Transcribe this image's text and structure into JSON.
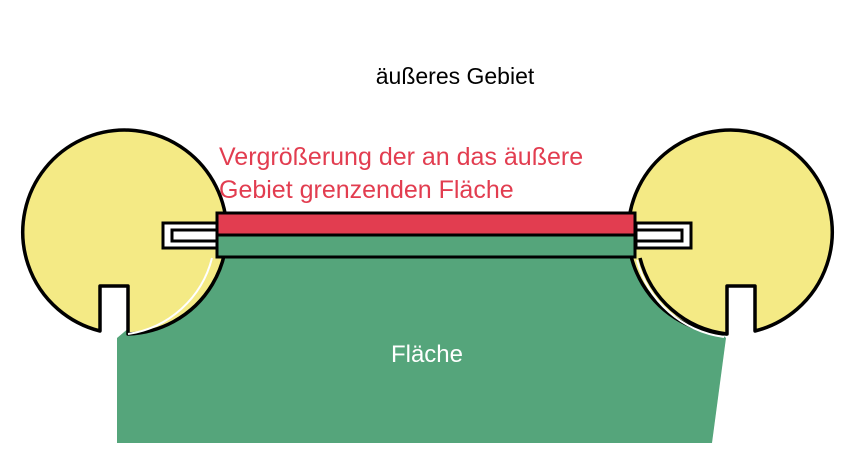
{
  "labels": {
    "outer_region": "äußeres Gebiet",
    "enlargement_line1": "Vergrößerung der an das äußere",
    "enlargement_line2": "Gebiet grenzenden Fläche",
    "area": "Fläche"
  },
  "colors": {
    "background": "#ffffff",
    "area_fill": "#55a57b",
    "enlargement_fill": "#e23d50",
    "circle_fill": "#f4ea85",
    "outline": "#000000",
    "enlargement_text": "#e23d50",
    "outer_text": "#000000",
    "area_text": "#ffffff"
  }
}
